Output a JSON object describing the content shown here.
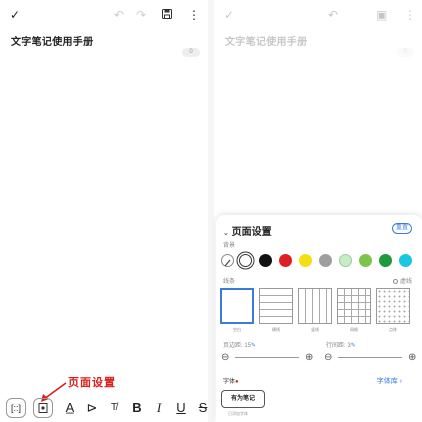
{
  "left": {
    "title": "文字笔记使用手册",
    "word_count_badge": "0",
    "annotation": "页面设置"
  },
  "right": {
    "title": "文字笔记使用手册",
    "word_count_badge": "0"
  },
  "toolbar": {
    "icons": [
      "expand-icon",
      "page-setting-icon",
      "text-color-icon",
      "highlighter-icon",
      "format-clear-icon",
      "bold-icon",
      "italic-icon",
      "underline-icon",
      "strikethrough-icon"
    ],
    "bold": "B",
    "italic": "I",
    "underline": "U",
    "strike": "S"
  },
  "panel": {
    "title": "页面设置",
    "reset": "重置",
    "background_label": "背景",
    "lines_label": "线条",
    "dashed_label": "虚线",
    "swatch_colors": [
      "#ffffff",
      "#111111",
      "#e02020",
      "#f4e012",
      "#9e9e9e",
      "#c8ecc8",
      "#7cc44a",
      "#1e9a3c",
      "#18c8e0"
    ],
    "patterns": [
      {
        "label": "空白"
      },
      {
        "label": "横线"
      },
      {
        "label": "竖线"
      },
      {
        "label": "网格"
      },
      {
        "label": "点阵"
      }
    ],
    "margin_label": "页边距",
    "margin_value": "15",
    "line_spacing_label": "行间距",
    "line_spacing_value": "3",
    "font_label": "字体",
    "font_library": "字体库",
    "font_chip": "有为笔记",
    "font_chip_sub": "已添加字体"
  },
  "colors": {
    "accent": "#3b7be0",
    "annotation": "#d92020"
  }
}
